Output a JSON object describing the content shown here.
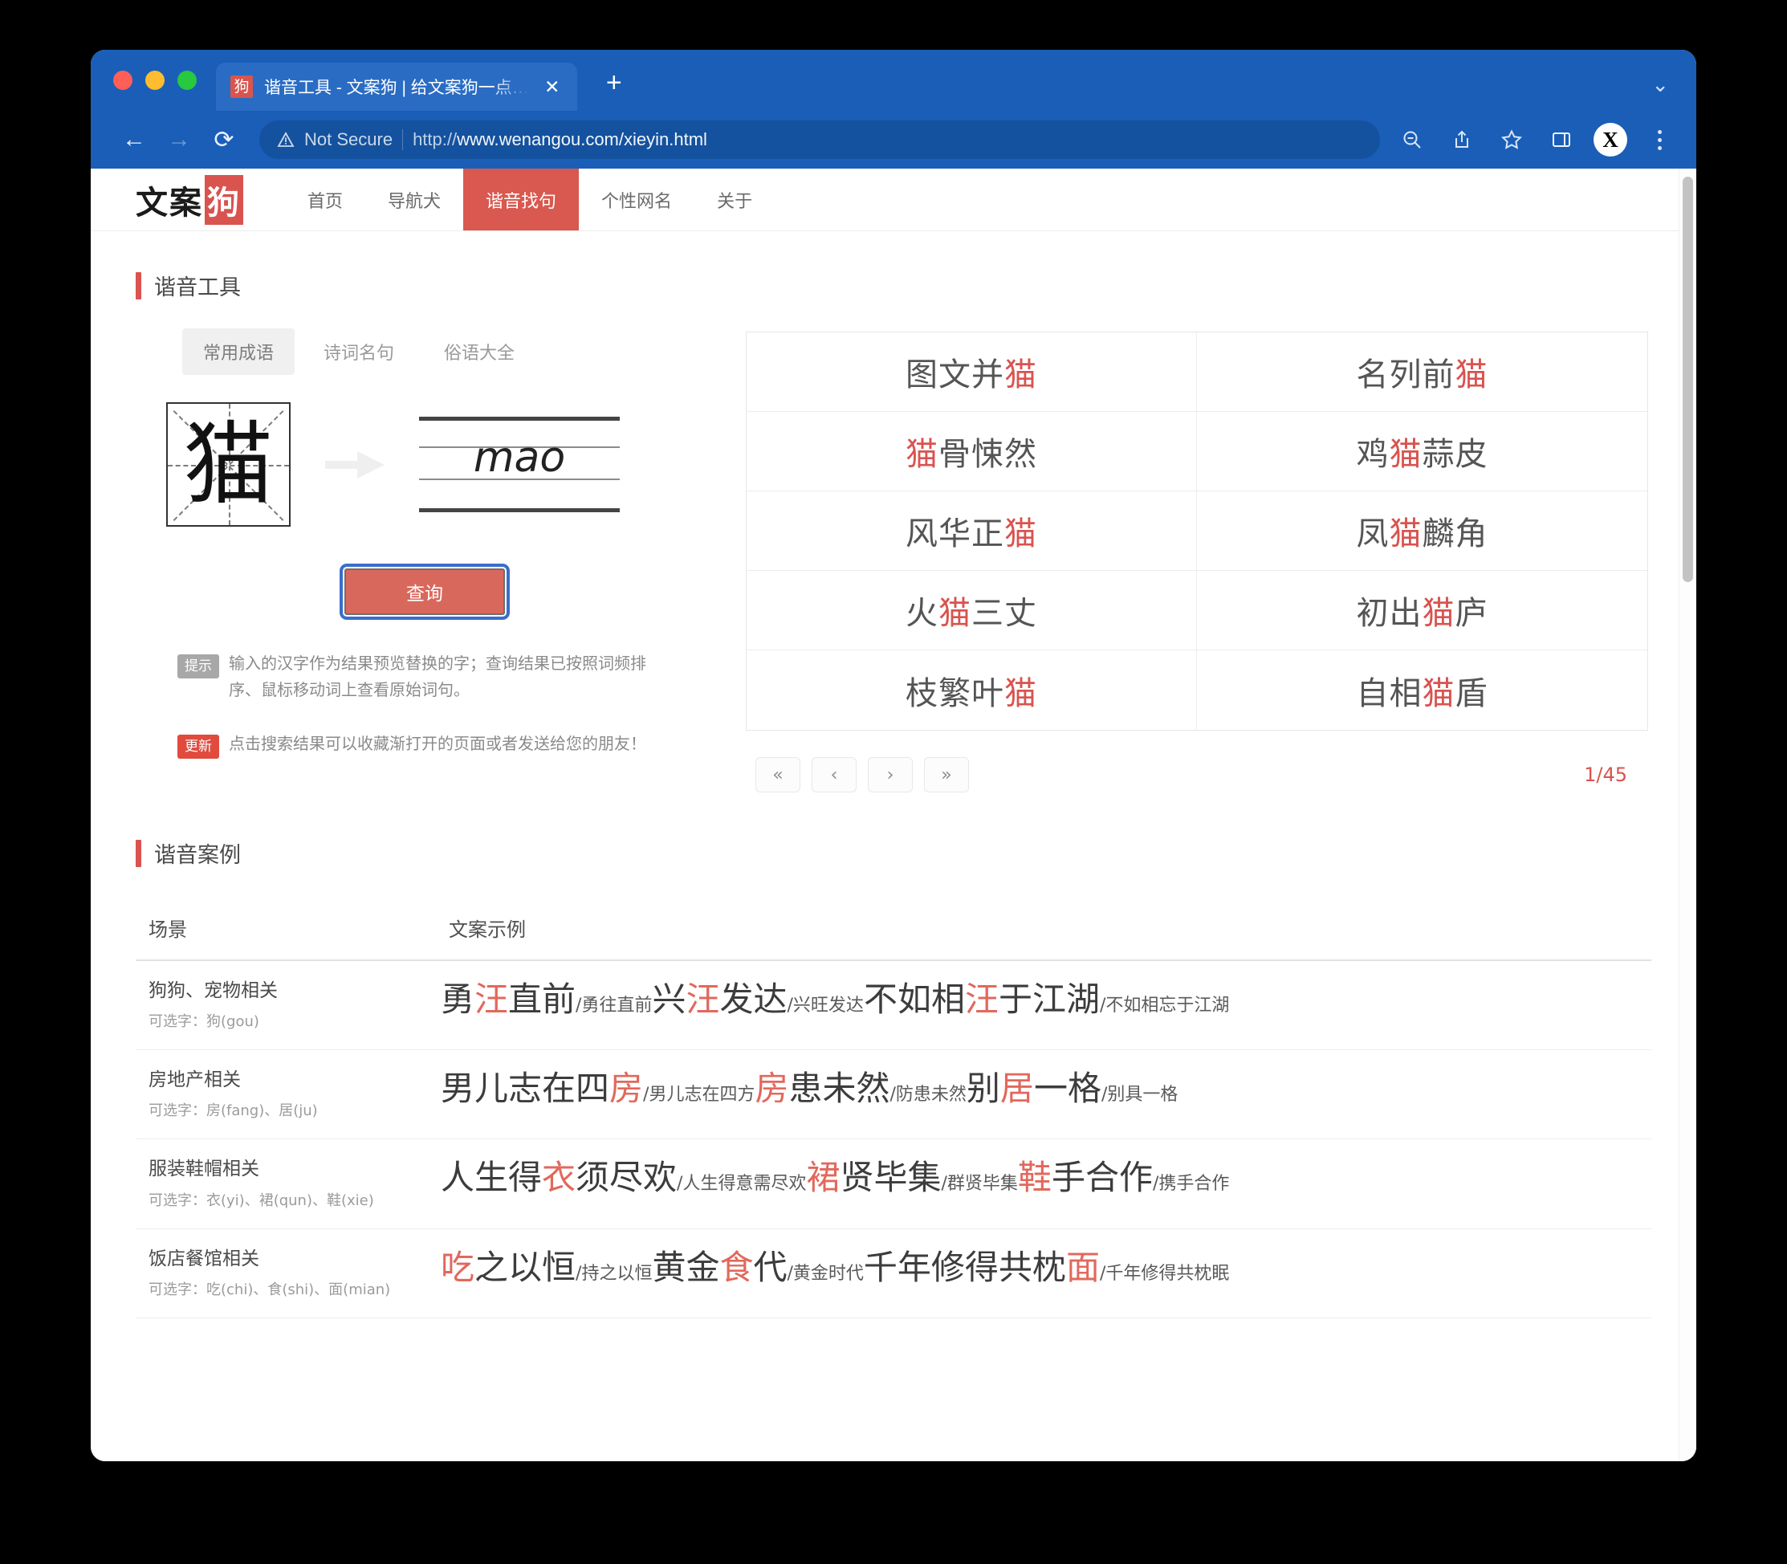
{
  "browser": {
    "tab": {
      "favicon_char": "狗",
      "title": "谐音工具 - 文案狗 | 给文案狗一点…",
      "close_label": "✕"
    },
    "new_tab_label": "+",
    "tab_list_chevron": "⌄",
    "nav": {
      "back": "←",
      "forward": "→",
      "reload": "⟳"
    },
    "omnibox": {
      "security_label": "Not Secure",
      "url_scheme": "http://",
      "url_rest": "www.wenangou.com/xieyin.html"
    },
    "toolbar_icons": [
      "zoom-out-icon",
      "share-icon",
      "bookmark-star-icon",
      "side-panel-icon",
      "profile-avatar",
      "browser-menu-icon"
    ],
    "avatar_letter": "X"
  },
  "site": {
    "logo": {
      "text": "文案",
      "highlight": "狗"
    },
    "nav_items": [
      {
        "label": "首页",
        "active": false
      },
      {
        "label": "导航犬",
        "active": false
      },
      {
        "label": "谐音找句",
        "active": true
      },
      {
        "label": "个性网名",
        "active": false
      },
      {
        "label": "关于",
        "active": false
      }
    ]
  },
  "tool_section": {
    "title": "谐音工具",
    "tabs": [
      {
        "label": "常用成语",
        "active": true
      },
      {
        "label": "诗词名句",
        "active": false
      },
      {
        "label": "俗语大全",
        "active": false
      }
    ],
    "input_char": "猫",
    "pinyin": "mao",
    "query_button": "查询",
    "hints": [
      {
        "badge": "提示",
        "badge_color": "#a8a8a8",
        "text": "输入的汉字作为结果预览替换的字；查询结果已按照词频排序、鼠标移动词上查看原始词句。"
      },
      {
        "badge": "更新",
        "badge_color": "#e04b3e",
        "text": "点击搜索结果可以收藏渐打开的页面或者发送给您的朋友！"
      }
    ],
    "results": [
      {
        "pre": "图文并",
        "hit": "猫",
        "post": ""
      },
      {
        "pre": "名列前",
        "hit": "猫",
        "post": ""
      },
      {
        "pre": "",
        "hit": "猫",
        "post": "骨悚然"
      },
      {
        "pre": "鸡",
        "hit": "猫",
        "post": "蒜皮"
      },
      {
        "pre": "风华正",
        "hit": "猫",
        "post": ""
      },
      {
        "pre": "凤",
        "hit": "猫",
        "post": "麟角"
      },
      {
        "pre": "火",
        "hit": "猫",
        "post": "三丈"
      },
      {
        "pre": "初出",
        "hit": "猫",
        "post": "庐"
      },
      {
        "pre": "枝繁叶",
        "hit": "猫",
        "post": ""
      },
      {
        "pre": "自相",
        "hit": "猫",
        "post": "盾"
      }
    ],
    "pagination": {
      "first": "«",
      "prev": "‹",
      "next": "›",
      "last": "»",
      "counter": "1/45"
    }
  },
  "cases_section": {
    "title": "谐音案例",
    "columns": {
      "scene": "场景",
      "examples": "文案示例"
    },
    "rows": [
      {
        "scene": "狗狗、宠物相关",
        "options": "可选字：狗(gou)",
        "examples": [
          {
            "pre": "勇",
            "hit": "汪",
            "post": "直前",
            "origin": "/勇往直前"
          },
          {
            "pre": "兴",
            "hit": "汪",
            "post": "发达",
            "origin": "/兴旺发达"
          },
          {
            "pre": "不如相",
            "hit": "汪",
            "post": "于江湖",
            "origin": "/不如相忘于江湖"
          }
        ]
      },
      {
        "scene": "房地产相关",
        "options": "可选字：房(fang)、居(ju)",
        "examples": [
          {
            "pre": "男儿志在四",
            "hit": "房",
            "post": "",
            "origin": "/男儿志在四方"
          },
          {
            "pre": "",
            "hit": "房",
            "post": "患未然",
            "origin": "/防患未然"
          },
          {
            "pre": "别",
            "hit": "居",
            "post": "一格",
            "origin": "/别具一格"
          }
        ]
      },
      {
        "scene": "服装鞋帽相关",
        "options": "可选字：衣(yi)、裙(qun)、鞋(xie)",
        "examples": [
          {
            "pre": "人生得",
            "hit": "衣",
            "post": "须尽欢",
            "origin": "/人生得意需尽欢"
          },
          {
            "pre": "",
            "hit": "裙",
            "post": "贤毕集",
            "origin": "/群贤毕集"
          },
          {
            "pre": "",
            "hit": "鞋",
            "post": "手合作",
            "origin": "/携手合作"
          }
        ]
      },
      {
        "scene": "饭店餐馆相关",
        "options": "可选字：吃(chi)、食(shi)、面(mian)",
        "examples": [
          {
            "pre": "",
            "hit": "吃",
            "post": "之以恒",
            "origin": "/持之以恒"
          },
          {
            "pre": "黄金",
            "hit": "食",
            "post": "代",
            "origin": "/黄金时代"
          },
          {
            "pre": "千年修得共枕",
            "hit": "面",
            "post": "",
            "origin": "/千年修得共枕眠"
          }
        ]
      }
    ]
  },
  "colors": {
    "accent_red": "#d9534f",
    "chrome_blue": "#1a5eb8",
    "button_red": "#d9685c"
  }
}
